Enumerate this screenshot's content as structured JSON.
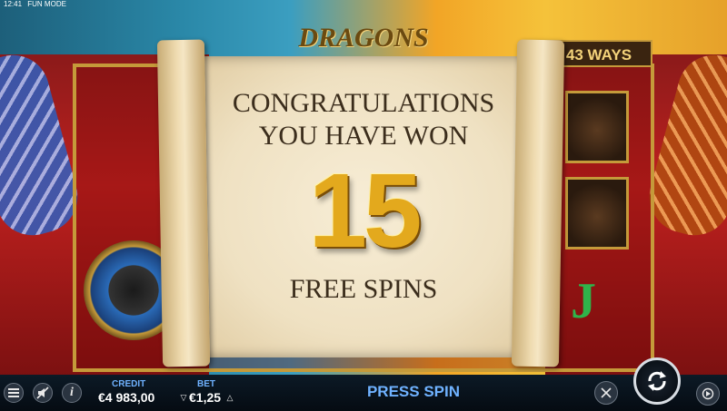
{
  "status": {
    "time": "12:41",
    "mode": "FUN MODE"
  },
  "game": {
    "logo_text": "DRAGONS",
    "ways_label": "43 WAYS"
  },
  "popup": {
    "line1": "CONGRATULATIONS",
    "line2": "YOU HAVE WON",
    "count": "15",
    "suffix": "FREE SPINS"
  },
  "bottom_bar": {
    "credit_label": "CREDIT",
    "credit_value": "€4 983,00",
    "bet_label": "BET",
    "bet_value": "€1,25",
    "press_spin": "PRESS SPIN",
    "icons": {
      "menu": "menu-icon",
      "sound": "sound-off-icon",
      "info": "info-icon",
      "turbo": "turbo-icon",
      "spin": "spin-icon",
      "autoplay": "autoplay-icon"
    }
  }
}
